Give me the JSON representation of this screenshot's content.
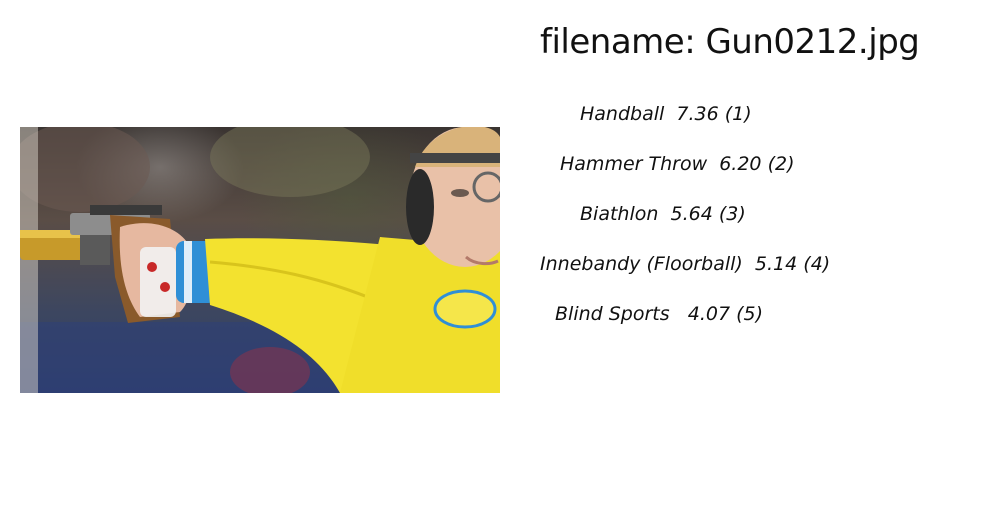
{
  "filename_line": "filename: Gun0212.jpg",
  "photo": {
    "icon": "photo-shooter-icon",
    "jersey_color": "#f3e22f",
    "sleeve_stripe_color": "#2f8fd6"
  },
  "results": [
    {
      "sport": "Handball",
      "score": "7.36",
      "rank": "(1)"
    },
    {
      "sport": "Hammer Throw",
      "score": "6.20",
      "rank": "(2)"
    },
    {
      "sport": "Biathlon",
      "score": "5.64",
      "rank": "(3)"
    },
    {
      "sport": "Innebandy (Floorball)",
      "score": "5.14",
      "rank": "(4)"
    },
    {
      "sport": "Blind Sports",
      "score": "4.07",
      "rank": "(5)"
    }
  ]
}
